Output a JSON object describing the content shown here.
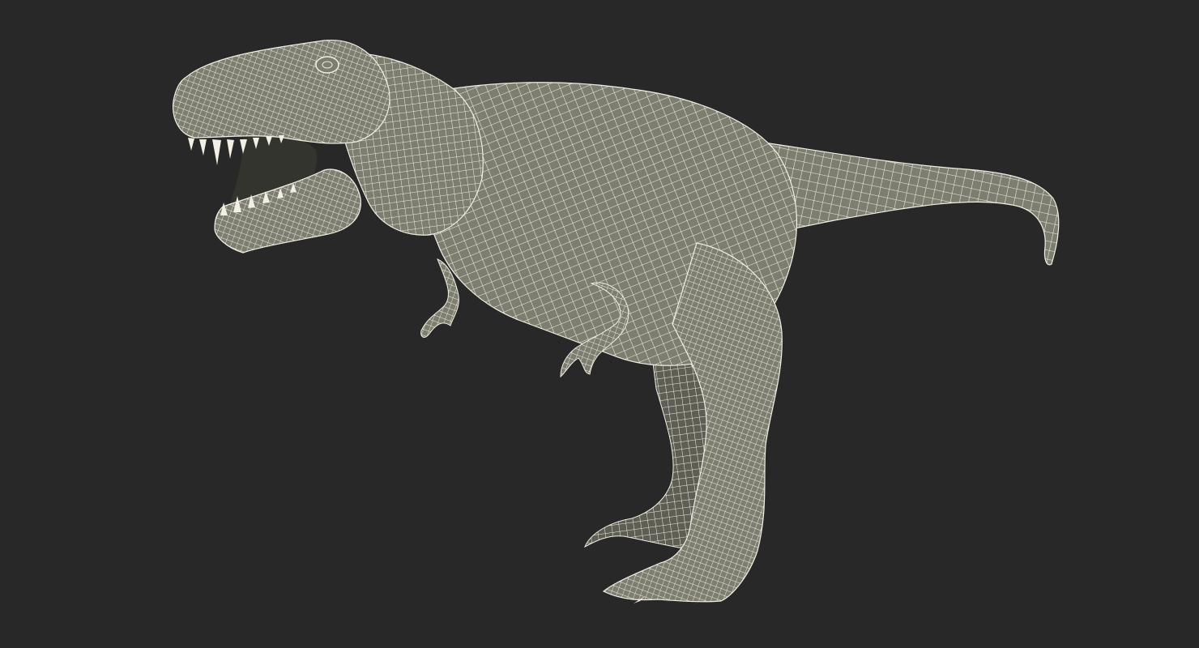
{
  "viewport": {
    "background_color": "#282828",
    "subject": "wireframe-dinosaur-model",
    "mesh_fill_color": "#7d7d70",
    "mesh_shadow_color": "#5e5e54",
    "wire_color": "#f2f0e4",
    "mouth_interior_color": "#34342e"
  }
}
